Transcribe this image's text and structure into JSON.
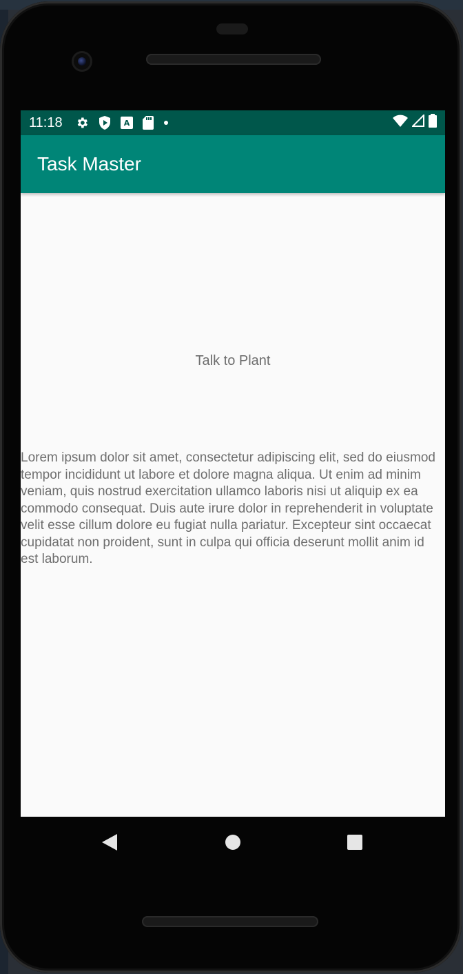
{
  "status_bar": {
    "time": "11:18",
    "left_icons": [
      "settings-icon",
      "shield-icon",
      "keyboard-a-icon",
      "sd-card-icon",
      "dot-icon"
    ],
    "right_icons": [
      "wifi-icon",
      "cell-signal-icon",
      "battery-icon"
    ],
    "background": "#00574b"
  },
  "app_bar": {
    "title": "Task Master",
    "background": "#008577"
  },
  "main": {
    "talk_button_label": "Talk to Plant",
    "body_text": "Lorem ipsum dolor sit amet, consectetur adipiscing elit, sed do eiusmod tempor incididunt ut labore et dolore magna aliqua. Ut enim ad minim veniam, quis nostrud exercitation ullamco laboris nisi ut aliquip ex ea commodo consequat. Duis aute irure dolor in reprehenderit in voluptate velit esse cillum dolore eu fugiat nulla pariatur. Excepteur sint occaecat cupidatat non proident, sunt in culpa qui officia deserunt mollit anim id est laborum."
  },
  "nav_bar": {
    "buttons": [
      "back-icon",
      "home-icon",
      "recents-icon"
    ]
  }
}
